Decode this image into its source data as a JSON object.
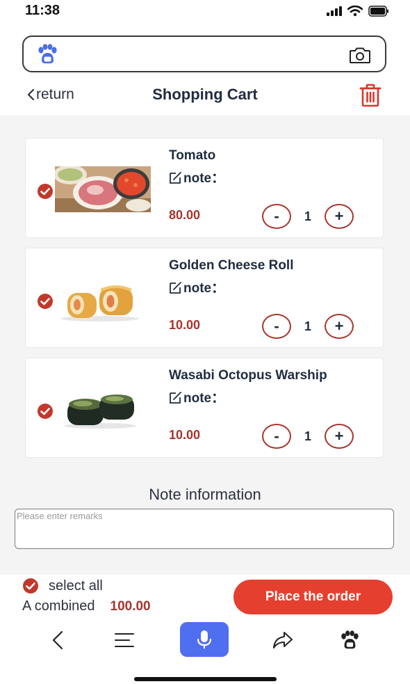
{
  "status_bar": {
    "time": "11:38"
  },
  "header": {
    "back_label": "return",
    "title": "Shopping Cart"
  },
  "items": [
    {
      "name": "Tomato",
      "note_label": "note：",
      "price": "80.00",
      "quantity": "1",
      "minus": "-",
      "plus": "+"
    },
    {
      "name": "Golden Cheese Roll",
      "note_label": "note：",
      "price": "10.00",
      "quantity": "1",
      "minus": "-",
      "plus": "+"
    },
    {
      "name": "Wasabi Octopus Warship",
      "note_label": "note：",
      "price": "10.00",
      "quantity": "1",
      "minus": "-",
      "plus": "+"
    }
  ],
  "note_section": {
    "title": "Note information",
    "placeholder": "Please enter remarks"
  },
  "summary": {
    "select_all_label": "select all",
    "combined_label": "A combined",
    "combined_total": "100.00",
    "order_button_label": "Place the order"
  },
  "colors": {
    "accent_red": "#a8342e",
    "button_red": "#e5402f",
    "mic_blue": "#4f6ef0",
    "paw_blue": "#4a6fe3"
  },
  "icons": [
    "paw-icon",
    "camera-icon",
    "trash-icon",
    "check-icon",
    "edit-icon",
    "back-arrow-icon",
    "menu-icon",
    "mic-icon",
    "share-icon"
  ]
}
